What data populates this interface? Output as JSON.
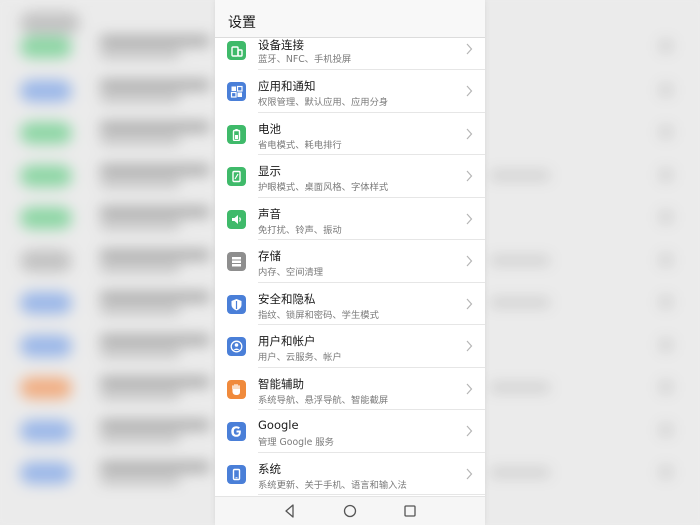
{
  "header": {
    "title": "设置"
  },
  "items": [
    {
      "key": "devices",
      "label": "设备连接",
      "sub": "蓝牙、NFC、手机投屏",
      "icon": "devices-icon",
      "color": "#3fba6a"
    },
    {
      "key": "apps",
      "label": "应用和通知",
      "sub": "权限管理、默认应用、应用分身",
      "icon": "apps-icon",
      "color": "#4a7fd8"
    },
    {
      "key": "battery",
      "label": "电池",
      "sub": "省电模式、耗电排行",
      "icon": "battery-icon",
      "color": "#3fba6a"
    },
    {
      "key": "display",
      "label": "显示",
      "sub": "护眼模式、桌面风格、字体样式",
      "icon": "display-icon",
      "color": "#3fba6a"
    },
    {
      "key": "sound",
      "label": "声音",
      "sub": "免打扰、铃声、振动",
      "icon": "speaker-icon",
      "color": "#3fba6a"
    },
    {
      "key": "storage",
      "label": "存储",
      "sub": "内存、空间清理",
      "icon": "storage-icon",
      "color": "#8e8e8e"
    },
    {
      "key": "security",
      "label": "安全和隐私",
      "sub": "指纹、锁屏和密码、学生模式",
      "icon": "shield-icon",
      "color": "#4a7fd8"
    },
    {
      "key": "accounts",
      "label": "用户和帐户",
      "sub": "用户、云服务、帐户",
      "icon": "user-icon",
      "color": "#4a7fd8"
    },
    {
      "key": "assist",
      "label": "智能辅助",
      "sub": "系统导航、悬浮导航、智能截屏",
      "icon": "hand-icon",
      "color": "#f08a3c"
    },
    {
      "key": "google",
      "label": "Google",
      "sub": "管理 Google 服务",
      "icon": "google-icon",
      "color": "#4a7fd8"
    },
    {
      "key": "system",
      "label": "系统",
      "sub": "系统更新、关于手机、语言和输入法",
      "icon": "phone-icon",
      "color": "#4a7fd8"
    }
  ],
  "nav": {
    "back": "back-icon",
    "home": "home-icon",
    "recents": "recents-icon"
  }
}
